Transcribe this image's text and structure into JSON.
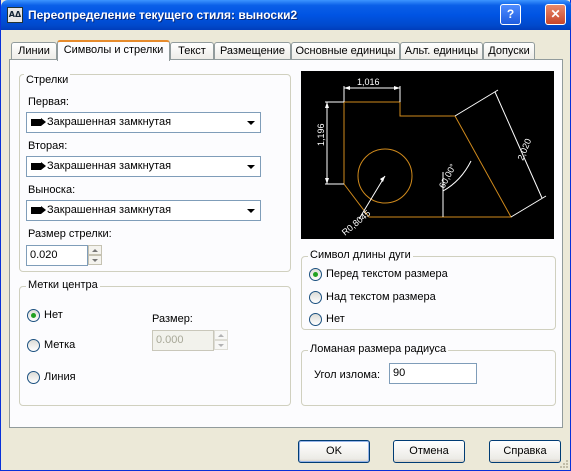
{
  "window": {
    "title": "Переопределение текущего стиля: выноски2",
    "app_icon_text": "AΔ",
    "help": "?",
    "close": "✕"
  },
  "tabs": [
    "Линии",
    "Символы и стрелки",
    "Текст",
    "Размещение",
    "Основные единицы",
    "Альт. единицы",
    "Допуски"
  ],
  "arrows": {
    "title": "Стрелки",
    "first_label": "Первая:",
    "first_value": "Закрашенная замкнутая",
    "second_label": "Вторая:",
    "second_value": "Закрашенная замкнутая",
    "leader_label": "Выноска:",
    "leader_value": "Закрашенная замкнутая",
    "size_label": "Размер стрелки:",
    "size_value": "0.020"
  },
  "center_marks": {
    "title": "Метки центра",
    "none": "Нет",
    "mark": "Метка",
    "line": "Линия",
    "size_label": "Размер:",
    "size_value": "0.000",
    "selected": "none"
  },
  "preview": {
    "dim_top": "1,016",
    "dim_left": "1,196",
    "dim_right": "2,020",
    "angle": "60,00°",
    "radius": "R0,8045"
  },
  "arc_symbol": {
    "title": "Символ длины дуги",
    "before": "Перед текстом размера",
    "above": "Над текстом размера",
    "none": "Нет",
    "selected": "before"
  },
  "jog": {
    "title": "Ломаная размера радиуса",
    "angle_label": "Угол излома:",
    "angle_value": "90"
  },
  "buttons": {
    "ok": "OK",
    "cancel": "Отмена",
    "help": "Справка"
  },
  "colors": {
    "title_bar": "#0054e3",
    "active_tab": "#e68b2c",
    "preview_bg": "#000000",
    "preview_geometry": "#d08a1c"
  }
}
